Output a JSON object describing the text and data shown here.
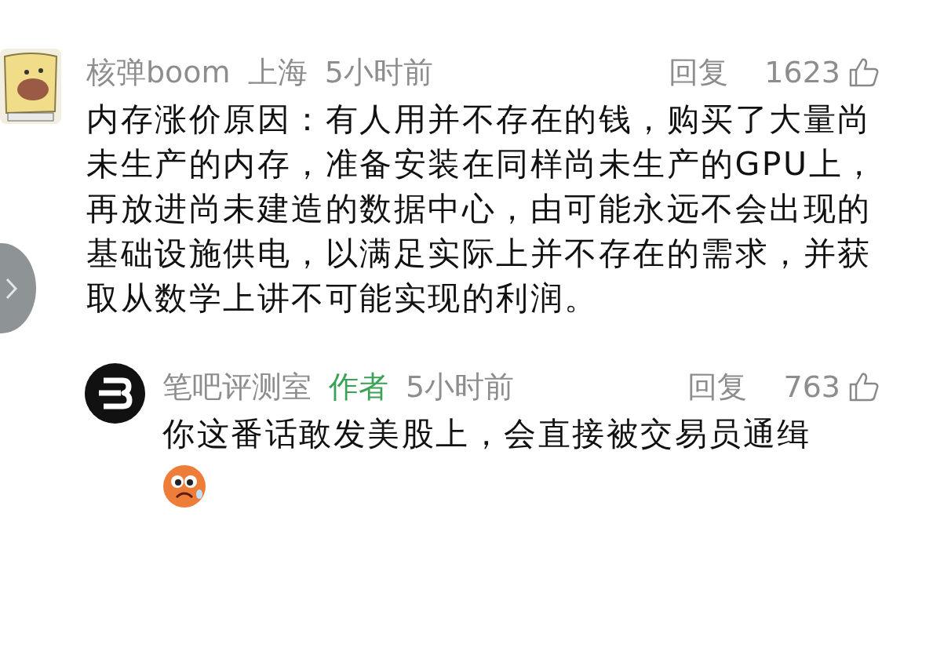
{
  "comments": [
    {
      "user": "核弹boom",
      "location": "上海",
      "time": "5小时前",
      "reply_label": "回复",
      "likes": "1623",
      "body": "内存涨价原因：有人用并不存在的钱，购买了大量尚未生产的内存，准备安装在同样尚未生产的GPU上，再放进尚未建造的数据中心，由可能永远不会出现的基础设施供电，以满足实际上并不存在的需求，并获取从数学上讲不可能实现的利润。",
      "replies": [
        {
          "user": "笔吧评测室",
          "badge": "作者",
          "time": "5小时前",
          "reply_label": "回复",
          "likes": "763",
          "body": "你这番话敢发美股上，会直接被交易员通缉",
          "sticker": true
        }
      ]
    }
  ]
}
